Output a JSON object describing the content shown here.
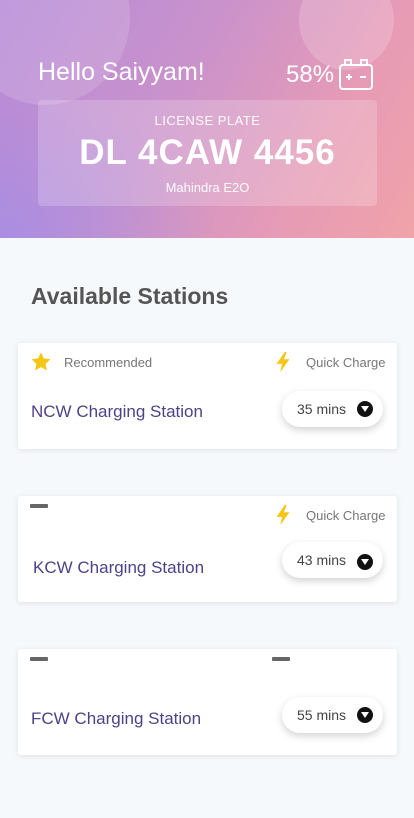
{
  "header": {
    "greeting": "Hello Saiyyam!",
    "battery_percent": "58%",
    "battery_icon": "car-battery-icon"
  },
  "plate": {
    "label": "LICENSE PLATE",
    "number": "DL 4CAW 4456",
    "model": "Mahindra E2O"
  },
  "section_title": "Available Stations",
  "colors": {
    "accent_text": "#4e4287",
    "bolt": "#f5c518",
    "star": "#f5c518"
  },
  "stations": [
    {
      "left_tag": "Recommended",
      "left_icon": "star-icon",
      "right_tag": "Quick Charge",
      "right_icon": "lightning-bolt-icon",
      "name": "NCW Charging Station",
      "time": "35 mins"
    },
    {
      "left_tag": "",
      "left_icon": "dash-icon",
      "right_tag": "Quick Charge",
      "right_icon": "lightning-bolt-icon",
      "name": "KCW Charging Station",
      "time": "43 mins"
    },
    {
      "left_tag": "",
      "left_icon": "dash-icon",
      "right_tag": "",
      "right_icon": "dash-icon",
      "name": "FCW Charging Station",
      "time": "55 mins"
    }
  ]
}
